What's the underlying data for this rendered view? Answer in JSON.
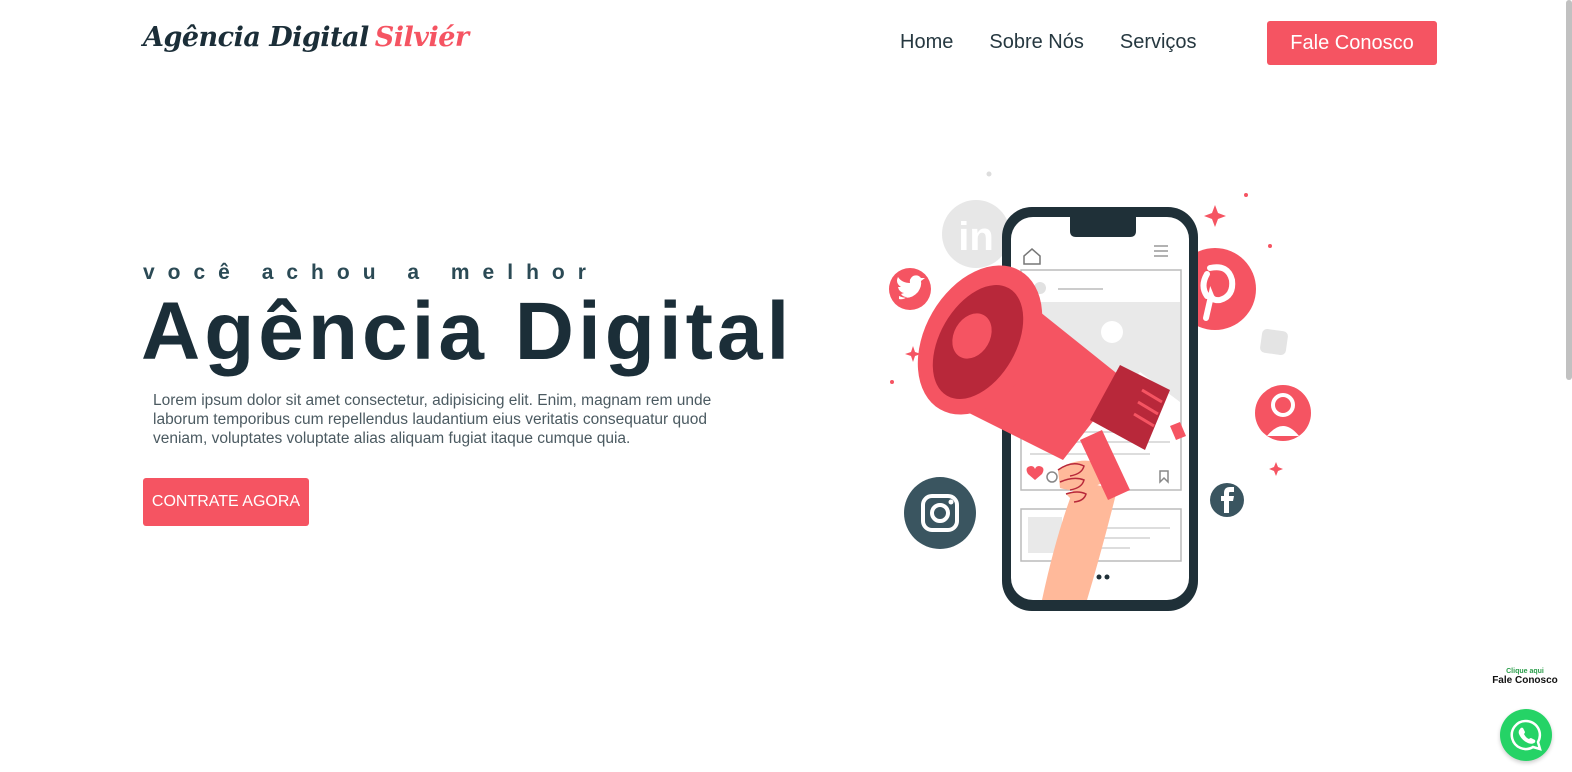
{
  "brand": {
    "name": "Agência Digital",
    "accent_name": "Silviér"
  },
  "nav": {
    "items": [
      {
        "label": "Home"
      },
      {
        "label": "Sobre Nós"
      },
      {
        "label": "Serviços"
      }
    ],
    "cta_label": "Fale Conosco"
  },
  "hero": {
    "kicker": "você achou a melhor",
    "title": "Agência Digital",
    "description": "Lorem ipsum dolor sit amet consectetur, adipisicing elit. Enim, magnam rem unde laborum temporibus cum repellendus laudantium eius veritatis consequatur quod veniam, voluptates voluptate alias aliquam fugiat itaque cumque quia.",
    "cta_label": "CONTRATE AGORA"
  },
  "whatsapp": {
    "hint_small": "Clique aqui",
    "hint_big": "Fale Conosco",
    "icon": "whatsapp-icon"
  },
  "colors": {
    "accent": "#f55462",
    "dark": "#1b2e38",
    "whatsapp": "#25d366"
  }
}
